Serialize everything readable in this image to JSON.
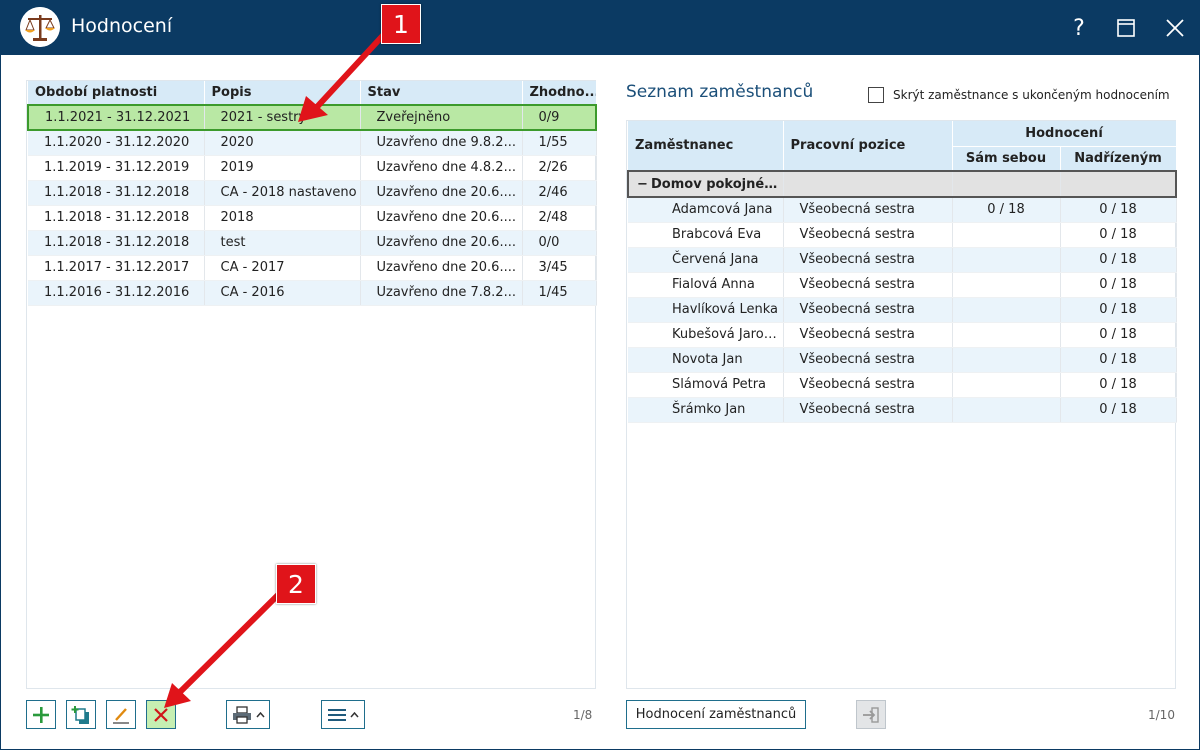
{
  "window": {
    "title": "Hodnocení",
    "help_label": "?"
  },
  "left_table": {
    "columns": [
      "Období platnosti",
      "Popis",
      "Stav",
      "Zhodno..."
    ],
    "rows": [
      [
        "1.1.2021 - 31.12.2021",
        "2021 - sestry",
        "Zveřejněno",
        "0/9"
      ],
      [
        "1.1.2020 - 31.12.2020",
        "2020",
        "Uzavřeno dne 9.8.2...",
        "1/55"
      ],
      [
        "1.1.2019 - 31.12.2019",
        "2019",
        "Uzavřeno dne 4.8.2...",
        "2/26"
      ],
      [
        "1.1.2018 - 31.12.2018",
        "CA - 2018 nastaveno",
        "Uzavřeno dne 20.6....",
        "2/46"
      ],
      [
        "1.1.2018 - 31.12.2018",
        "2018",
        "Uzavřeno dne 20.6....",
        "2/48"
      ],
      [
        "1.1.2018 - 31.12.2018",
        "test",
        "Uzavřeno dne 20.6....",
        "0/0"
      ],
      [
        "1.1.2017 - 31.12.2017",
        "CA - 2017",
        "Uzavřeno dne 20.6....",
        "3/45"
      ],
      [
        "1.1.2016 - 31.12.2016",
        "CA - 2016",
        "Uzavřeno dne 7.8.2...",
        "1/45"
      ]
    ],
    "pager": "1/8"
  },
  "right": {
    "title": "Seznam zaměstnanců",
    "hide_checkbox_label": "Skrýt zaměstnance s ukončeným hodnocením",
    "col_employee": "Zaměstnanec",
    "col_position": "Pracovní pozice",
    "col_rating": "Hodnocení",
    "col_self": "Sám sebou",
    "col_superior": "Nadřízeným",
    "group_label": "Domov pokojnéh...",
    "employees": [
      [
        "Adamcová Jana",
        "Všeobecná sestra",
        "0 / 18",
        "0 / 18"
      ],
      [
        "Brabcová Eva",
        "Všeobecná sestra",
        "",
        "0 / 18"
      ],
      [
        "Červená Jana",
        "Všeobecná sestra",
        "",
        "0 / 18"
      ],
      [
        "Fialová Anna",
        "Všeobecná sestra",
        "",
        "0 / 18"
      ],
      [
        "Havlíková Lenka",
        "Všeobecná sestra",
        "",
        "0 / 18"
      ],
      [
        "Kubešová Jarosl...",
        "Všeobecná sestra",
        "",
        "0 / 18"
      ],
      [
        "Novota Jan",
        "Všeobecná sestra",
        "",
        "0 / 18"
      ],
      [
        "Slámová Petra",
        "Všeobecná sestra",
        "",
        "0 / 18"
      ],
      [
        "Šrámko Jan",
        "Všeobecná sestra",
        "",
        "0 / 18"
      ]
    ],
    "eval_button_label": "Hodnocení zaměstnanců",
    "pager": "1/10"
  },
  "annotations": {
    "callout_1": "1",
    "callout_2": "2"
  },
  "icons": {
    "add": "plus-icon",
    "copy": "copy-add-icon",
    "edit": "pencil-icon",
    "delete": "close-x-icon",
    "print": "printer-icon",
    "menu": "hamburger-menu-icon",
    "export": "export-arrow-icon"
  },
  "colors": {
    "titlebar": "#0b3a63",
    "header": "#d7eaf7",
    "selected_row": "#b9e8a4",
    "callout": "#e0141a"
  }
}
